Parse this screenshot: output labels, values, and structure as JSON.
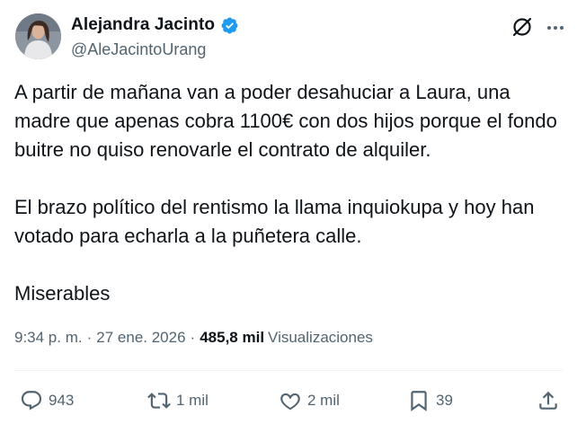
{
  "author": {
    "name": "Alejandra Jacinto",
    "handle": "@AleJacintoUrang"
  },
  "tweet": {
    "paragraphs": [
      "A partir de mañana van a poder desahuciar a Laura, una madre que apenas cobra 1100€ con dos hijos porque el fondo buitre no quiso renovarle el contrato de alquiler.",
      "El brazo político del rentismo la llama inquiokupa y hoy han votado para echarla a la puñetera calle.",
      "Miserables"
    ],
    "time": "9:34 p. m.",
    "date": "27 ene. 2026",
    "views_count": "485,8 mil",
    "views_label": "Visualizaciones"
  },
  "actions": {
    "replies": "943",
    "reposts": "1 mil",
    "likes": "2 mil",
    "bookmarks": "39"
  },
  "icons": {
    "verified": "verified-badge-icon",
    "grok": "grok-icon",
    "more": "more-dots-icon",
    "reply": "reply-icon",
    "repost": "repost-icon",
    "like": "heart-icon",
    "bookmark": "bookmark-icon",
    "share": "share-icon"
  },
  "colors": {
    "verified": "#1d9bf0",
    "text": "#0f1419",
    "secondary": "#536471"
  }
}
